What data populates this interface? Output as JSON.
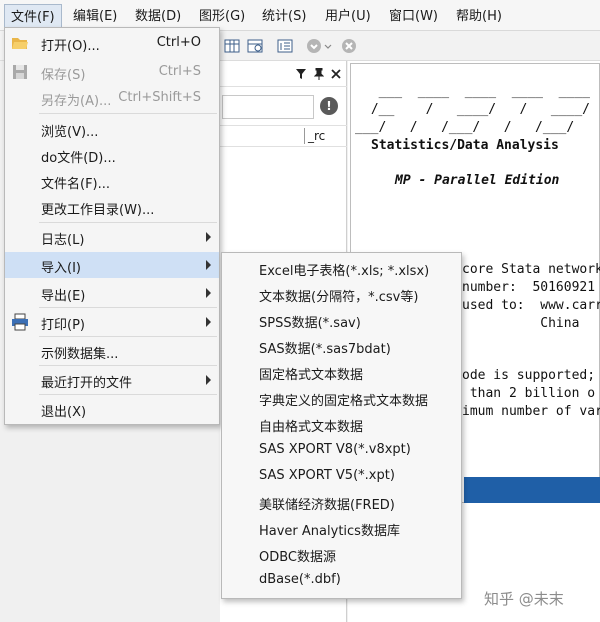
{
  "menubar": {
    "items": [
      "文件(F)",
      "编辑(E)",
      "数据(D)",
      "图形(G)",
      "统计(S)",
      "用户(U)",
      "窗口(W)",
      "帮助(H)"
    ]
  },
  "file_menu": {
    "items": [
      {
        "label": "打开(O)...",
        "shortcut": "Ctrl+O",
        "icon": "folder-open-icon"
      },
      {
        "label": "保存(S)",
        "shortcut": "Ctrl+S",
        "icon": "save-icon",
        "disabled": true
      },
      {
        "label": "另存为(A)...",
        "shortcut": "Ctrl+Shift+S",
        "disabled": true
      },
      {
        "label": "浏览(V)..."
      },
      {
        "label": "do文件(D)..."
      },
      {
        "label": "文件名(F)..."
      },
      {
        "label": "更改工作目录(W)..."
      },
      {
        "label": "日志(L)",
        "submenu": true
      },
      {
        "label": "导入(I)",
        "submenu": true,
        "highlighted": true
      },
      {
        "label": "导出(E)",
        "submenu": true
      },
      {
        "label": "打印(P)",
        "submenu": true,
        "icon": "printer-icon"
      },
      {
        "label": "示例数据集..."
      },
      {
        "label": "最近打开的文件",
        "submenu": true
      },
      {
        "label": "退出(X)"
      }
    ]
  },
  "import_submenu": {
    "items": [
      "Excel电子表格(*.xls; *.xlsx)",
      "文本数据(分隔符，*.csv等)",
      "SPSS数据(*.sav)",
      "SAS数据(*.sas7bdat)",
      "固定格式文本数据",
      "字典定义的固定格式文本数据",
      "自由格式文本数据",
      "SAS XPORT V8(*.v8xpt)",
      "SAS XPORT V5(*.xpt)",
      "美联储经济数据(FRED)",
      "Haver Analytics数据库",
      "ODBC数据源",
      "dBase(*.dbf)"
    ]
  },
  "variables_panel": {
    "column_label": "_rc",
    "info_glyph": "!"
  },
  "results": {
    "logo_lines": [
      "  ___  ____  ____  ____  ____  (",
      " /__    /   ____/   /   ____/",
      "___/   /   /___/   /   /___/"
    ],
    "subtitle": "Statistics/Data Analysis",
    "edition": "MP - Parallel Edition",
    "lines": [
      "core Stata network",
      "number:  50160921",
      "used to:  www.carr",
      "          China",
      "ode is supported;",
      " than 2 billion o",
      "imum number of var"
    ]
  },
  "watermark": "知乎 @未末",
  "colors": {
    "menu_highlight": "#cfe0f5",
    "command_bar": "#1f5fa7"
  }
}
